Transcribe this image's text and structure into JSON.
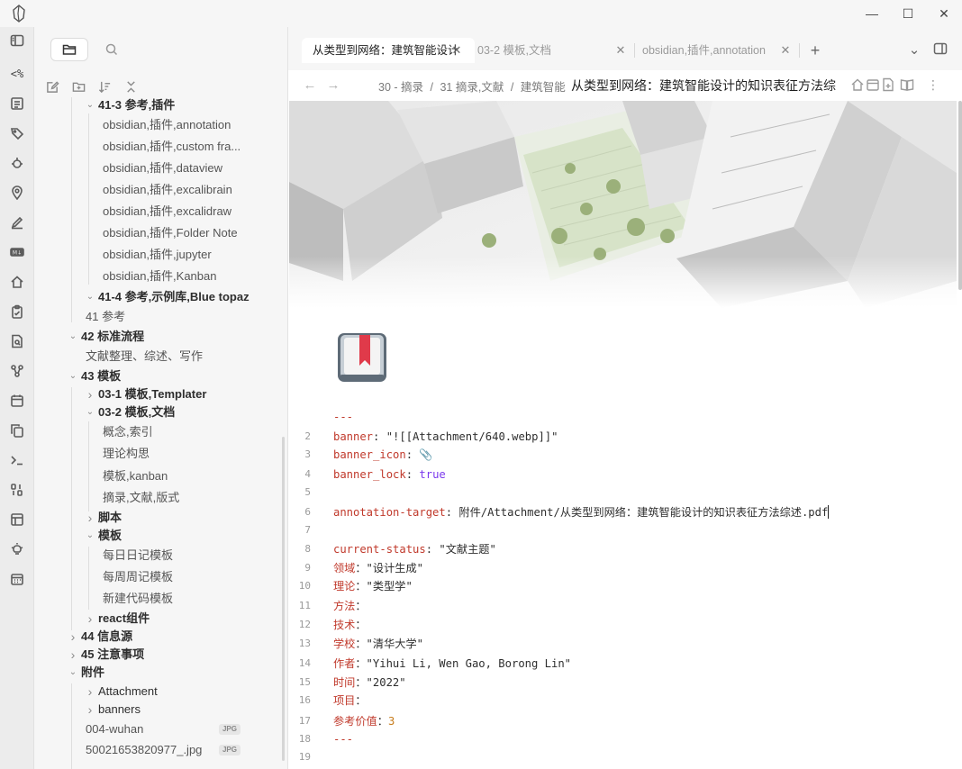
{
  "window": {
    "controls": [
      "—",
      "☐",
      "✕"
    ]
  },
  "ribbon": {
    "icons": [
      "sidebar-toggle-icon",
      "template-icon",
      "list-icon",
      "tag-icon",
      "bug-icon",
      "map-pin-icon",
      "pencil-icon",
      "markdown-icon",
      "home-icon",
      "clipboard-icon",
      "search-file-icon",
      "graph-icon",
      "calendar-icon",
      "copy-icon",
      "terminal-icon",
      "binary-icon",
      "layout-icon",
      "lightbulb-icon",
      "calendar-grid-icon"
    ],
    "template_label": "<%"
  },
  "sidebar": {
    "tree": [
      {
        "label": "41-3 参考,插件",
        "type": "folder",
        "level": 1,
        "open": true
      },
      {
        "label": "obsidian,插件,annotation",
        "type": "file",
        "level": 2
      },
      {
        "label": "obsidian,插件,custom fra...",
        "type": "file",
        "level": 2
      },
      {
        "label": "obsidian,插件,dataview",
        "type": "file",
        "level": 2
      },
      {
        "label": "obsidian,插件,excalibrain",
        "type": "file",
        "level": 2
      },
      {
        "label": "obsidian,插件,excalidraw",
        "type": "file",
        "level": 2
      },
      {
        "label": "obsidian,插件,Folder Note",
        "type": "file",
        "level": 2
      },
      {
        "label": "obsidian,插件,jupyter",
        "type": "file",
        "level": 2
      },
      {
        "label": "obsidian,插件,Kanban",
        "type": "file",
        "level": 2
      },
      {
        "label": "41-4 参考,示例库,Blue topaz",
        "type": "folder",
        "level": 1,
        "open": true
      },
      {
        "label": "41 参考",
        "type": "file",
        "level": 1
      },
      {
        "label": "42 标准流程",
        "type": "folder",
        "level": 0,
        "open": true
      },
      {
        "label": "文献整理、综述、写作",
        "type": "file",
        "level": 1
      },
      {
        "label": "43 模板",
        "type": "folder",
        "level": 0,
        "open": true
      },
      {
        "label": "03-1 模板,Templater",
        "type": "folder",
        "level": 1,
        "open": false
      },
      {
        "label": "03-2 模板,文档",
        "type": "folder",
        "level": 1,
        "open": true
      },
      {
        "label": "概念,索引",
        "type": "file",
        "level": 2
      },
      {
        "label": "理论构思",
        "type": "file",
        "level": 2
      },
      {
        "label": "模板,kanban",
        "type": "file",
        "level": 2
      },
      {
        "label": "摘录,文献,版式",
        "type": "file",
        "level": 2
      },
      {
        "label": "脚本",
        "type": "folder",
        "level": 1,
        "open": false
      },
      {
        "label": "模板",
        "type": "folder",
        "level": 1,
        "open": true
      },
      {
        "label": "每日日记模板",
        "type": "file",
        "level": 2
      },
      {
        "label": "每周周记模板",
        "type": "file",
        "level": 2
      },
      {
        "label": "新建代码模板",
        "type": "file",
        "level": 2
      },
      {
        "label": "react组件",
        "type": "folder",
        "level": 1,
        "open": false
      },
      {
        "label": "44 信息源",
        "type": "folder",
        "level": 0,
        "open": false
      },
      {
        "label": "45 注意事项",
        "type": "folder",
        "level": 0,
        "open": false
      },
      {
        "label": "附件",
        "type": "folder",
        "level": 0,
        "open": true
      },
      {
        "label": "Attachment",
        "type": "folder",
        "level": 1,
        "open": false,
        "plain": true
      },
      {
        "label": "banners",
        "type": "folder",
        "level": 1,
        "open": false,
        "plain": true
      },
      {
        "label": "004-wuhan",
        "type": "file",
        "level": 1,
        "badge": "JPG"
      },
      {
        "label": "50021653820977_.jpg",
        "type": "file",
        "level": 1,
        "badge": "JPG"
      }
    ]
  },
  "tabs": [
    {
      "label": "从类型到网络：建筑智能设计",
      "active": true
    },
    {
      "label": "03-2 模板,文档",
      "active": false
    },
    {
      "label": "obsidian,插件,annotation",
      "active": false
    }
  ],
  "tab_actions": {
    "new_tab": "+",
    "tab_list": "⌄"
  },
  "viewheader": {
    "back": "←",
    "forward": "→",
    "breadcrumbs": [
      "30 - 摘录",
      "31 摘录,文献",
      "建筑智能"
    ],
    "separator": "/",
    "title": "从类型到网络：建筑智能设计的知识表征方法综"
  },
  "editor": {
    "lines": [
      {
        "num": "",
        "segments": [
          {
            "t": "---",
            "c": "dash"
          }
        ]
      },
      {
        "num": "2",
        "segments": [
          {
            "t": "banner",
            "c": "k"
          },
          {
            "t": ": \"![[Attachment/640.webp]]\"",
            "c": "p"
          }
        ]
      },
      {
        "num": "3",
        "segments": [
          {
            "t": "banner_icon",
            "c": "k"
          },
          {
            "t": ": ",
            "c": "p"
          }
        ],
        "icon": "📎"
      },
      {
        "num": "4",
        "segments": [
          {
            "t": "banner_lock",
            "c": "k"
          },
          {
            "t": ": ",
            "c": "p"
          },
          {
            "t": "true",
            "c": "b"
          }
        ]
      },
      {
        "num": "5",
        "segments": []
      },
      {
        "num": "6",
        "segments": [
          {
            "t": "annotation-target",
            "c": "k"
          },
          {
            "t": ": 附件/Attachment/从类型到网络：建筑智能设计的知识表征方法综述.pdf",
            "c": "p"
          }
        ],
        "caret": true
      },
      {
        "num": "7",
        "segments": []
      },
      {
        "num": "8",
        "segments": [
          {
            "t": "current-status",
            "c": "k"
          },
          {
            "t": ": \"文献主题\"",
            "c": "p"
          }
        ]
      },
      {
        "num": "9",
        "segments": [
          {
            "t": "领域",
            "c": "k"
          },
          {
            "t": "：\"设计生成\"",
            "c": "p"
          }
        ]
      },
      {
        "num": "10",
        "segments": [
          {
            "t": "理论",
            "c": "k"
          },
          {
            "t": "：\"类型学\"",
            "c": "p"
          }
        ]
      },
      {
        "num": "11",
        "segments": [
          {
            "t": "方法",
            "c": "k"
          },
          {
            "t": "：",
            "c": "p"
          }
        ]
      },
      {
        "num": "12",
        "segments": [
          {
            "t": "技术",
            "c": "k"
          },
          {
            "t": "：",
            "c": "p"
          }
        ]
      },
      {
        "num": "13",
        "segments": [
          {
            "t": "学校",
            "c": "k"
          },
          {
            "t": "：\"清华大学\"",
            "c": "p"
          }
        ]
      },
      {
        "num": "14",
        "segments": [
          {
            "t": "作者",
            "c": "k"
          },
          {
            "t": "：\"Yihui Li, Wen Gao, Borong Lin\"",
            "c": "p"
          }
        ]
      },
      {
        "num": "15",
        "segments": [
          {
            "t": "时间",
            "c": "k"
          },
          {
            "t": "：\"2022\"",
            "c": "p"
          }
        ]
      },
      {
        "num": "16",
        "segments": [
          {
            "t": "项目",
            "c": "k"
          },
          {
            "t": "：",
            "c": "p"
          }
        ]
      },
      {
        "num": "17",
        "segments": [
          {
            "t": "参考价值",
            "c": "k"
          },
          {
            "t": "：",
            "c": "p"
          },
          {
            "t": "3",
            "c": "n"
          }
        ]
      },
      {
        "num": "18",
        "segments": [
          {
            "t": "---",
            "c": "dash"
          }
        ]
      },
      {
        "num": "19",
        "segments": []
      }
    ]
  },
  "colors": {
    "accent": "#7c3aed",
    "key": "#c0392b",
    "number": "#c77c1c",
    "sidebar_bg": "#f6f6f6",
    "ribbon_bg": "#ececec"
  }
}
